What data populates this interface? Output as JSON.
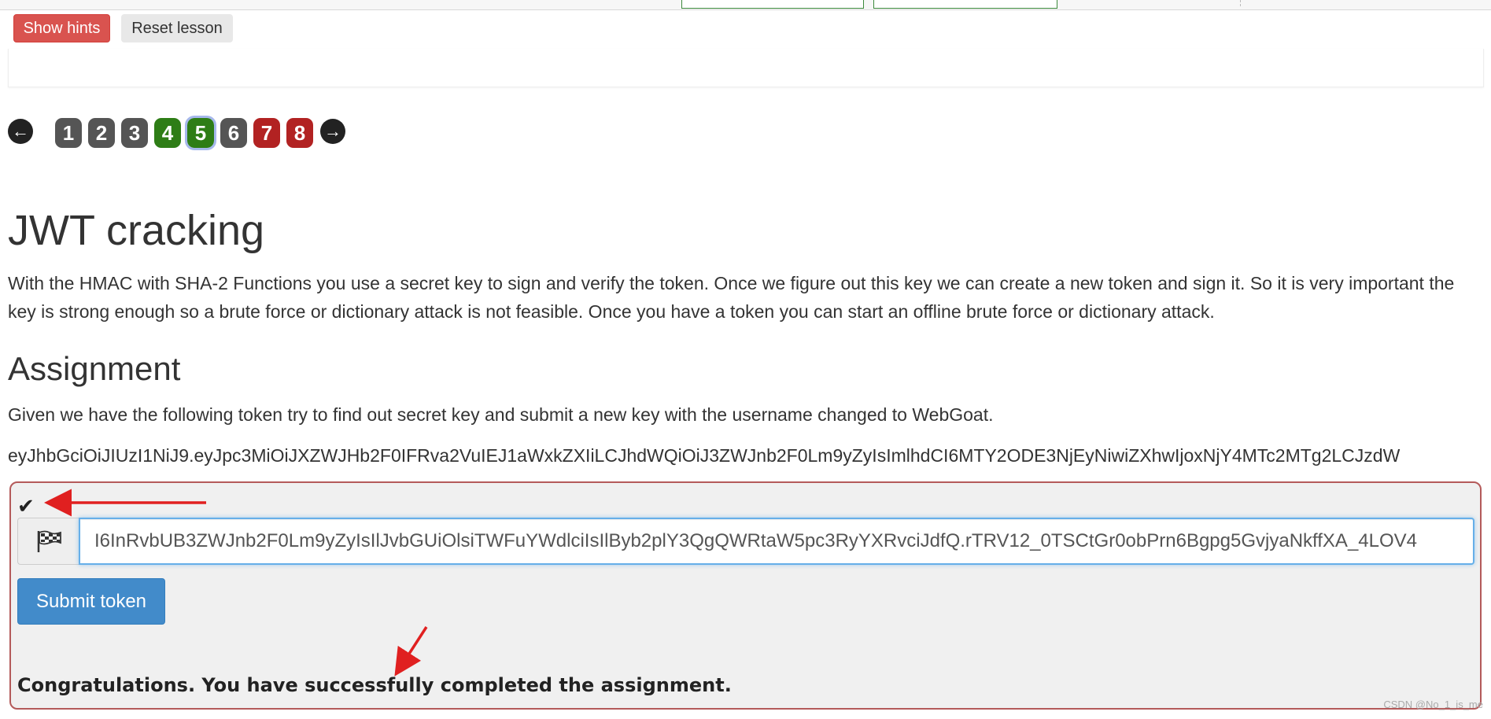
{
  "header": {
    "show_hints": "Show hints",
    "reset_lesson": "Reset lesson"
  },
  "pagination": {
    "prev_icon": "arrow-left-icon",
    "next_icon": "arrow-right-icon",
    "pages": [
      {
        "label": "1",
        "status": "gray"
      },
      {
        "label": "2",
        "status": "gray"
      },
      {
        "label": "3",
        "status": "gray"
      },
      {
        "label": "4",
        "status": "green"
      },
      {
        "label": "5",
        "status": "green"
      },
      {
        "label": "6",
        "status": "gray"
      },
      {
        "label": "7",
        "status": "red"
      },
      {
        "label": "8",
        "status": "red"
      }
    ],
    "current": "5"
  },
  "lesson": {
    "title": "JWT cracking",
    "description": "With the HMAC with SHA-2 Functions you use a secret key to sign and verify the token. Once we figure out this key we can create a new token and sign it. So it is very important the key is strong enough so a brute force or dictionary attack is not feasible. Once you have a token you can start an offline brute force or dictionary attack.",
    "assignment_heading": "Assignment",
    "assignment_text": "Given we have the following token try to find out secret key and submit a new key with the username changed to WebGoat.",
    "token": "eyJhbGciOiJIUzI1NiJ9.eyJpc3MiOiJXZWJHb2F0IFRva2VuIEJ1aWxkZXIiLCJhdWQiOiJ3ZWJnb2F0Lm9yZyIsImlhdCI6MTY2ODE3NjEyNiwiZXhwIjoxNjY4MTc2MTg2LCJzdW"
  },
  "form": {
    "input_value": "I6InRvbUB3ZWJnb2F0Lm9yZyIsIlJvbGUiOlsiTWFuYWdlciIsIlByb2plY3QgQWRtaW5pc3RyYXRvciJdfQ.rTRV12_0TSCtGr0obPrn6Bgpg5GvjyaNkffXA_4LOV4",
    "submit_label": "Submit token",
    "check_icon": "checkmark-icon",
    "flag_icon": "flag-icon",
    "success_message": "Congratulations. You have successfully completed the assignment."
  },
  "watermark": "CSDN @No_1_is_me",
  "colors": {
    "hints_button": "#d9534f",
    "submit_button": "#428bca",
    "page_green": "#2e7d16",
    "page_red": "#b22222",
    "page_gray": "#555555",
    "annotation_arrow": "#e02020"
  }
}
